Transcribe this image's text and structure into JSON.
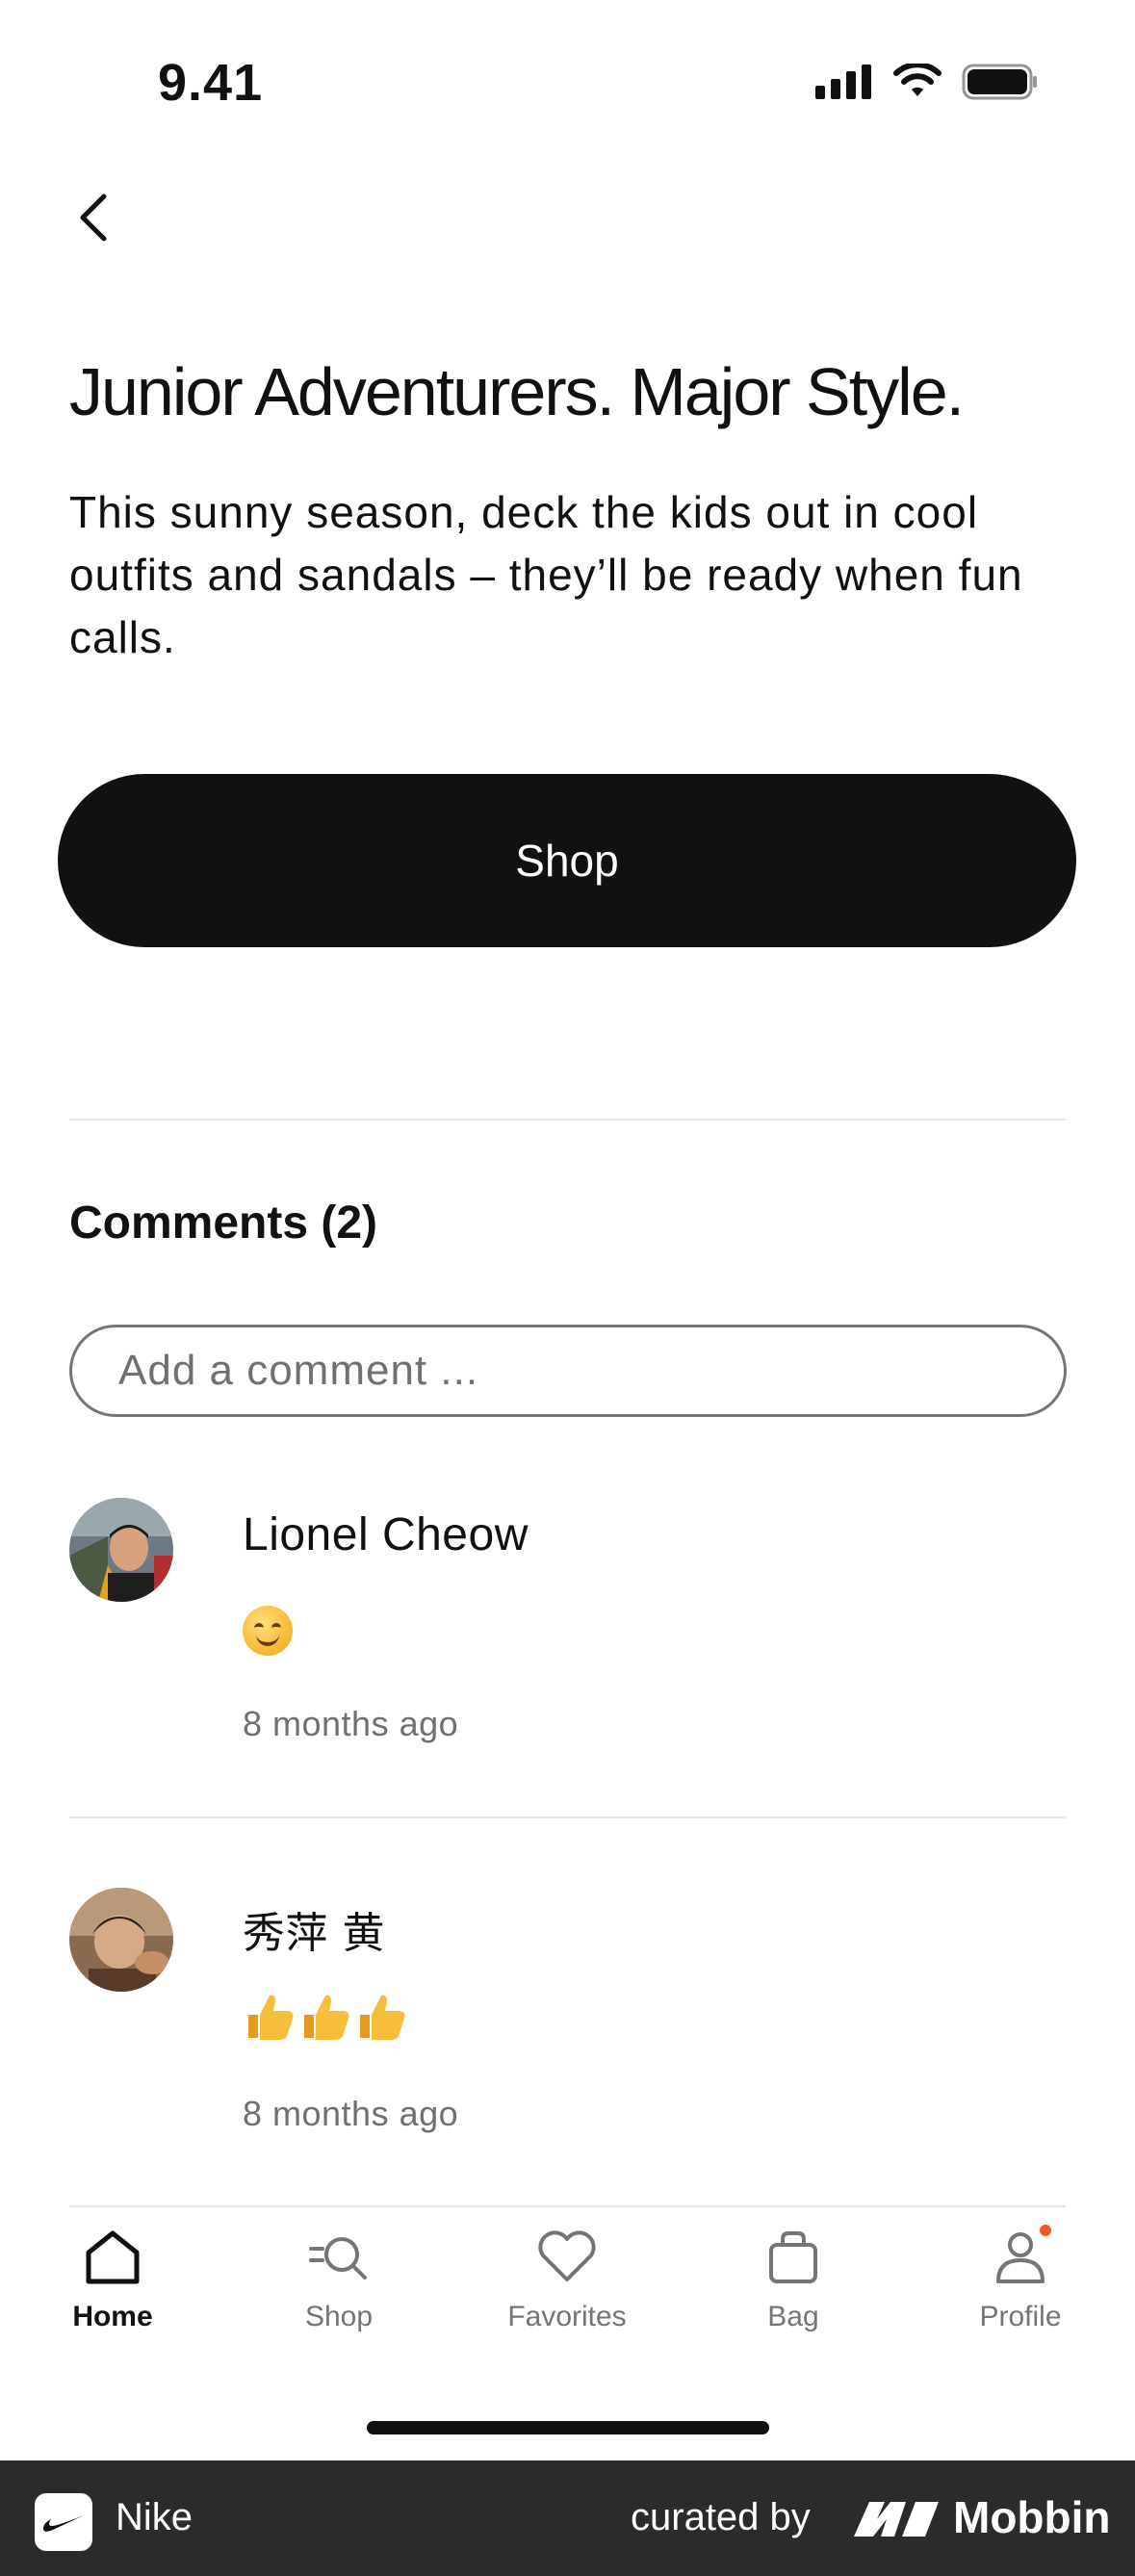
{
  "status_bar": {
    "time": "9.41",
    "icons": [
      "signal-icon",
      "wifi-icon",
      "battery-icon"
    ]
  },
  "header": {
    "back_icon": "chevron-left-icon"
  },
  "story": {
    "headline": "Junior Adventurers. Major Style.",
    "body": "This sunny season, deck the kids out in cool outfits and sandals – they’ll be ready when fun calls.",
    "cta_label": "Shop"
  },
  "comments": {
    "title": "Comments (2)",
    "input_placeholder": "Add a comment ...",
    "items": [
      {
        "name": "Lionel Cheow",
        "body": "😊",
        "time": "8 months ago"
      },
      {
        "name": "秀萍 黄",
        "body": "👍👍👍",
        "time": "8 months ago"
      }
    ]
  },
  "tabbar": {
    "tabs": [
      {
        "label": "Home",
        "icon": "home-icon",
        "active": true
      },
      {
        "label": "Shop",
        "icon": "search-icon",
        "active": false
      },
      {
        "label": "Favorites",
        "icon": "heart-icon",
        "active": false
      },
      {
        "label": "Bag",
        "icon": "bag-icon",
        "active": false
      },
      {
        "label": "Profile",
        "icon": "profile-icon",
        "active": false,
        "badge": true
      }
    ],
    "badge_color": "#f05a23"
  },
  "footer": {
    "app_name": "Nike",
    "curated_by": "curated by",
    "brand": "Mobbin"
  },
  "colors": {
    "primary": "#111111",
    "muted": "#707070",
    "divider": "#e5e5e5",
    "footer_bg": "#2b2b2b"
  }
}
